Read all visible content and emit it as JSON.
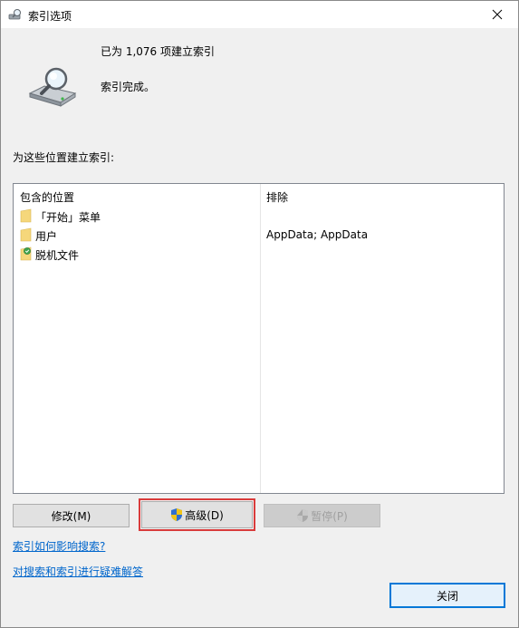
{
  "window": {
    "title": "索引选项"
  },
  "status": {
    "count_text": "已为 1,076 项建立索引",
    "done_text": "索引完成。"
  },
  "locations_label": "为这些位置建立索引:",
  "table": {
    "headers": {
      "included": "包含的位置",
      "excluded": "排除"
    },
    "rows": [
      {
        "location": "「开始」菜单",
        "exclude": ""
      },
      {
        "location": "用户",
        "exclude": "AppData; AppData"
      },
      {
        "location": "脱机文件",
        "exclude": ""
      }
    ]
  },
  "buttons": {
    "modify": "修改(M)",
    "advanced": "高级(D)",
    "pause": "暂停(P)",
    "close": "关闭"
  },
  "links": {
    "how_affects": "索引如何影响搜索?",
    "troubleshoot": "对搜索和索引进行疑难解答"
  },
  "colors": {
    "link": "#0066cc",
    "highlight": "#d93b3b",
    "folder": "#f5d77b"
  }
}
